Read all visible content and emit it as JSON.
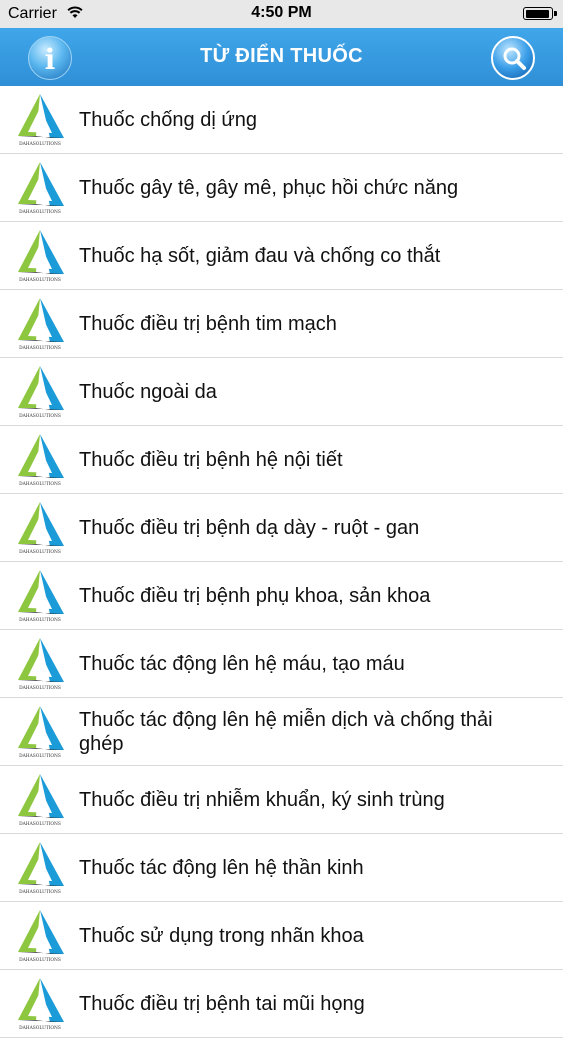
{
  "status_bar": {
    "carrier": "Carrier",
    "time": "4:50 PM",
    "wifi_icon": "wifi-icon",
    "battery_icon": "battery-icon"
  },
  "nav": {
    "title": "TỪ ĐIỂN THUỐC",
    "info_button_glyph": "i",
    "info_icon": "info-icon",
    "search_icon": "magnifier-icon"
  },
  "logo": {
    "icon": "dahasolutions-triangle-logo",
    "text": "DAHASOLUTIONS",
    "colors": [
      "#8dc63f",
      "#1b9bd7",
      "#2b2f3a"
    ]
  },
  "categories": [
    "Thuốc chống dị ứng",
    "Thuốc gây tê, gây mê, phục hồi chức năng",
    "Thuốc hạ sốt, giảm đau và chống co thắt",
    "Thuốc điều trị bệnh tim mạch",
    "Thuốc ngoài da",
    "Thuốc điều trị bệnh hệ nội tiết",
    "Thuốc điều trị bệnh dạ dày - ruột - gan",
    "Thuốc điều trị bệnh phụ khoa, sản khoa",
    "Thuốc tác động lên hệ máu, tạo máu",
    "Thuốc tác động lên hệ miễn dịch và chống thải ghép",
    "Thuốc điều trị nhiễm khuẩn, ký sinh trùng",
    "Thuốc tác động lên hệ thần kinh",
    "Thuốc sử dụng trong nhãn khoa",
    "Thuốc điều trị bệnh tai mũi họng"
  ]
}
